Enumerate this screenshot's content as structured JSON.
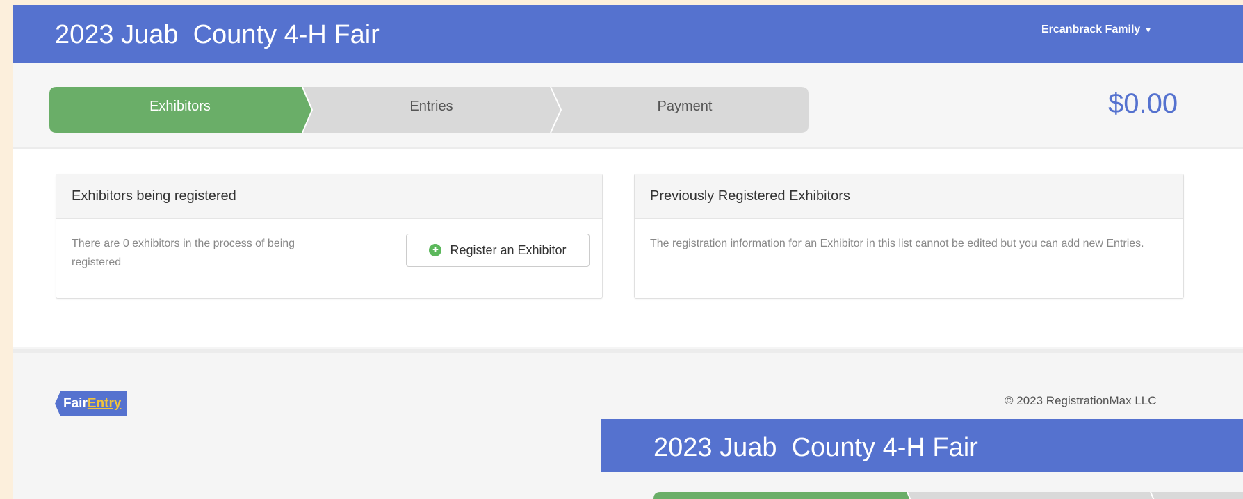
{
  "header": {
    "title": "2023 Juab  County 4-H Fair",
    "user_menu_label": "Ercanbrack Family"
  },
  "steps": {
    "items": [
      {
        "label": "Exhibitors",
        "active": true
      },
      {
        "label": "Entries",
        "active": false
      },
      {
        "label": "Payment",
        "active": false
      }
    ],
    "total": "$0.00"
  },
  "panels": {
    "registering": {
      "title": "Exhibitors being registered",
      "body": "There are 0 exhibitors in the process of being registered",
      "button_label": "Register an Exhibitor"
    },
    "previous": {
      "title": "Previously Registered Exhibitors",
      "body": "The registration information for an Exhibitor in this list cannot be edited but you can add new Entries."
    }
  },
  "footer": {
    "logo_part1": "Fair",
    "logo_part2": "Entry",
    "copyright": "© 2023 RegistrationMax LLC"
  },
  "overlay": {
    "title": "2023 Juab  County 4-H Fair"
  },
  "colors": {
    "brand_blue": "#5572cf",
    "active_green": "#6aae68",
    "inactive_gray": "#d9d9d9",
    "logo_accent": "#f2c43c"
  }
}
